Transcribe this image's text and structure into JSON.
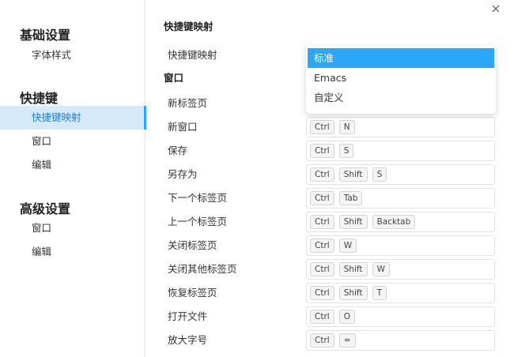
{
  "sidebar": {
    "sections": [
      {
        "title": "基础设置",
        "items": [
          "字体样式"
        ]
      },
      {
        "title": "快捷键",
        "items": [
          "快捷键映射",
          "窗口",
          "编辑"
        ]
      },
      {
        "title": "高级设置",
        "items": [
          "窗口",
          "编辑"
        ]
      }
    ],
    "active_item": "快捷键映射"
  },
  "main": {
    "title": "快捷键映射",
    "mapping_label": "快捷键映射",
    "group_title": "窗口",
    "shortcuts": [
      {
        "label": "新标签页",
        "keys": []
      },
      {
        "label": "新窗口",
        "keys": [
          "Ctrl",
          "N"
        ]
      },
      {
        "label": "保存",
        "keys": [
          "Ctrl",
          "S"
        ]
      },
      {
        "label": "另存为",
        "keys": [
          "Ctrl",
          "Shift",
          "S"
        ]
      },
      {
        "label": "下一个标签页",
        "keys": [
          "Ctrl",
          "Tab"
        ]
      },
      {
        "label": "上一个标签页",
        "keys": [
          "Ctrl",
          "Shift",
          "Backtab"
        ]
      },
      {
        "label": "关闭标签页",
        "keys": [
          "Ctrl",
          "W"
        ]
      },
      {
        "label": "关闭其他标签页",
        "keys": [
          "Ctrl",
          "Shift",
          "W"
        ]
      },
      {
        "label": "恢复标签页",
        "keys": [
          "Ctrl",
          "Shift",
          "T"
        ]
      },
      {
        "label": "打开文件",
        "keys": [
          "Ctrl",
          "O"
        ]
      },
      {
        "label": "放大字号",
        "keys": [
          "Ctrl",
          "="
        ]
      }
    ]
  },
  "dropdown": {
    "options": [
      "标准",
      "Emacs",
      "自定义"
    ],
    "selected": "标准"
  },
  "colors": {
    "accent": "#2ca7f8",
    "active_bg": "#d6e9f9",
    "active_text": "#1a7fd4"
  },
  "icons": {
    "close": "close-icon"
  }
}
